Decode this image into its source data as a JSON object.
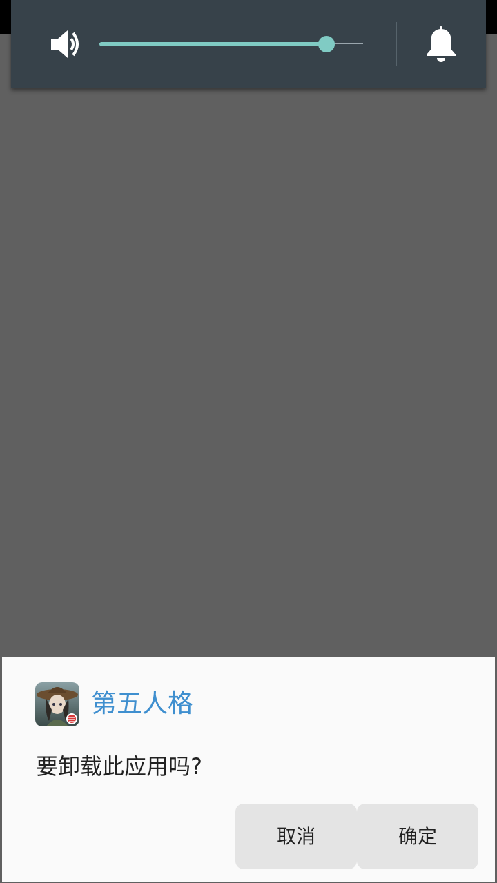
{
  "volume": {
    "level_percent": 86,
    "icons": {
      "speaker": "volume-speaker-icon",
      "bell": "bell-icon"
    },
    "colors": {
      "panel_background": "#37424a",
      "accent": "#80cbc4"
    }
  },
  "dialog": {
    "app_name": "第五人格",
    "message": "要卸载此应用吗?",
    "cancel_label": "取消",
    "confirm_label": "确定",
    "app_icon": "identity-v-app-icon",
    "colors": {
      "title": "#3f8fcf",
      "background": "#fafafa",
      "button": "#e4e4e4"
    }
  },
  "background": {
    "dim_color": "#606060"
  }
}
